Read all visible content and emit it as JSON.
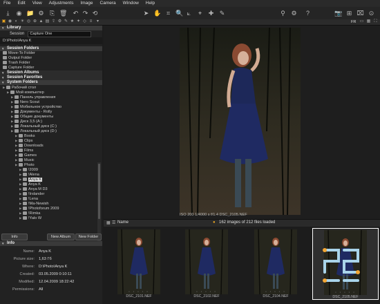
{
  "menu": [
    "File",
    "Edit",
    "View",
    "Adjustments",
    "Image",
    "Camera",
    "Window",
    "Help"
  ],
  "toolbar": {
    "icons": [
      "import-icon",
      "capture-icon",
      "open-folder-icon",
      "process-icon",
      "copy-icon",
      "delete-icon",
      "rotate-left-icon",
      "rotate-right-icon",
      "reset-icon",
      "cursor-icon",
      "hand-icon",
      "crop-icon",
      "zoom-icon",
      "straighten-icon",
      "keystone-icon",
      "picker-icon",
      "pen-icon",
      "loupe-icon",
      "preferences-icon",
      "help-icon",
      "camera-icon",
      "grid-icon",
      "crop-overlay-icon",
      "focus-icon"
    ]
  },
  "tabs": {
    "label": "FR"
  },
  "library": {
    "title": "Library",
    "session_label": "Session",
    "session_value": "Capture One",
    "path": "D:\\Photo\\Anya K",
    "session_folders_title": "Session Folders",
    "session_folders": [
      "Move-To Folder",
      "Output Folder",
      "Trash Folder",
      "Capture Folder"
    ],
    "session_albums": "Session Albums",
    "session_favorites": "Session Favorites",
    "system_folders_title": "System Folders",
    "tree": [
      {
        "label": "Рабочий стол",
        "depth": 0
      },
      {
        "label": "Мой компьютер",
        "depth": 1
      },
      {
        "label": "Панель управления",
        "depth": 2
      },
      {
        "label": "Nero Scout",
        "depth": 2
      },
      {
        "label": "Мобильное устройство",
        "depth": 2
      },
      {
        "label": "Документы - Rolly",
        "depth": 2
      },
      {
        "label": "Общие документы",
        "depth": 2
      },
      {
        "label": "Диск 3,5 (A:)",
        "depth": 2
      },
      {
        "label": "Локальный диск (C:)",
        "depth": 2
      },
      {
        "label": "Локальный диск (D:)",
        "depth": 2
      },
      {
        "label": "Books",
        "depth": 3
      },
      {
        "label": "Clips",
        "depth": 3
      },
      {
        "label": "Downloads",
        "depth": 3
      },
      {
        "label": "Films",
        "depth": 3
      },
      {
        "label": "Games",
        "depth": 3
      },
      {
        "label": "Music",
        "depth": 3
      },
      {
        "label": "Photo",
        "depth": 3
      },
      {
        "label": "!2009",
        "depth": 4
      },
      {
        "label": "!Alena",
        "depth": 4
      },
      {
        "label": "Anya K",
        "depth": 4,
        "selected": true
      },
      {
        "label": "Anya K",
        "depth": 4
      },
      {
        "label": "Anya M D3",
        "depth": 4
      },
      {
        "label": "!Irslander",
        "depth": 4
      },
      {
        "label": "!Lena",
        "depth": 4
      },
      {
        "label": "!Ma-Newish",
        "depth": 4
      },
      {
        "label": "!Photoforum 2009",
        "depth": 4
      },
      {
        "label": "!Rimka",
        "depth": 4
      },
      {
        "label": "!Yalo W",
        "depth": 4
      }
    ],
    "buttons": {
      "info": "Info",
      "new_album": "New Album",
      "new_folder": "New Folder"
    }
  },
  "info": {
    "title": "Info",
    "fields": [
      {
        "k": "Name:",
        "v": "Anya K"
      },
      {
        "k": "Picture size:",
        "v": "1,63 Гб"
      },
      {
        "k": "Where:",
        "v": "D:\\Photo\\Anya K"
      },
      {
        "k": "Created:",
        "v": "03.05.2009 0:10:11"
      },
      {
        "k": "Modified:",
        "v": "12.04.2009 18:22:42"
      },
      {
        "k": "Permissions:",
        "v": "All"
      }
    ]
  },
  "viewer": {
    "caption": "ISO 200   1/4000 s   f/1.4          DSC_2105.NEF"
  },
  "browser": {
    "sort_label": "Name",
    "status": "162 images of 212 files loaded"
  },
  "thumbnails": [
    {
      "name": "DSC_2101.NEF"
    },
    {
      "name": "DSC_2102.NEF"
    },
    {
      "name": "DSC_2104.NEF"
    },
    {
      "name": "DSC_2105.NEF",
      "selected": true
    }
  ],
  "colors": {
    "accent": "#e7a321",
    "background": "#1c1c1c"
  }
}
